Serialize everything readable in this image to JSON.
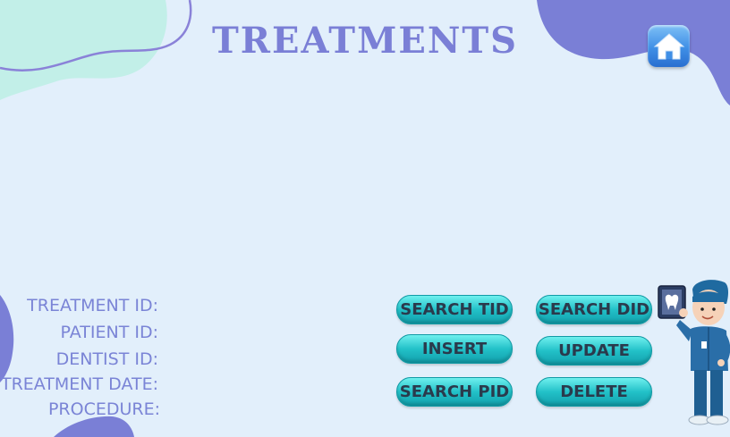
{
  "header": {
    "title": "TREATMENTS"
  },
  "nav": {
    "home_icon": "home-icon"
  },
  "form": {
    "treatment_id_label": "TREATMENT ID:",
    "patient_id_label": "PATIENT ID:",
    "dentist_id_label": "DENTIST ID:",
    "treatment_date_label": "TREATMENT DATE:",
    "procedure_label": "PROCEDURE:"
  },
  "buttons": {
    "search_tid": "SEARCH TID",
    "search_did": "SEARCH DID",
    "insert": "INSERT",
    "update": "UPDATE",
    "search_pid": "SEARCH PID",
    "delete": "DELETE"
  },
  "colors": {
    "background": "#e2effb",
    "accent": "#7a7fd6",
    "mint_blob": "#c2efe8",
    "button_teal": "#22c1c8"
  }
}
